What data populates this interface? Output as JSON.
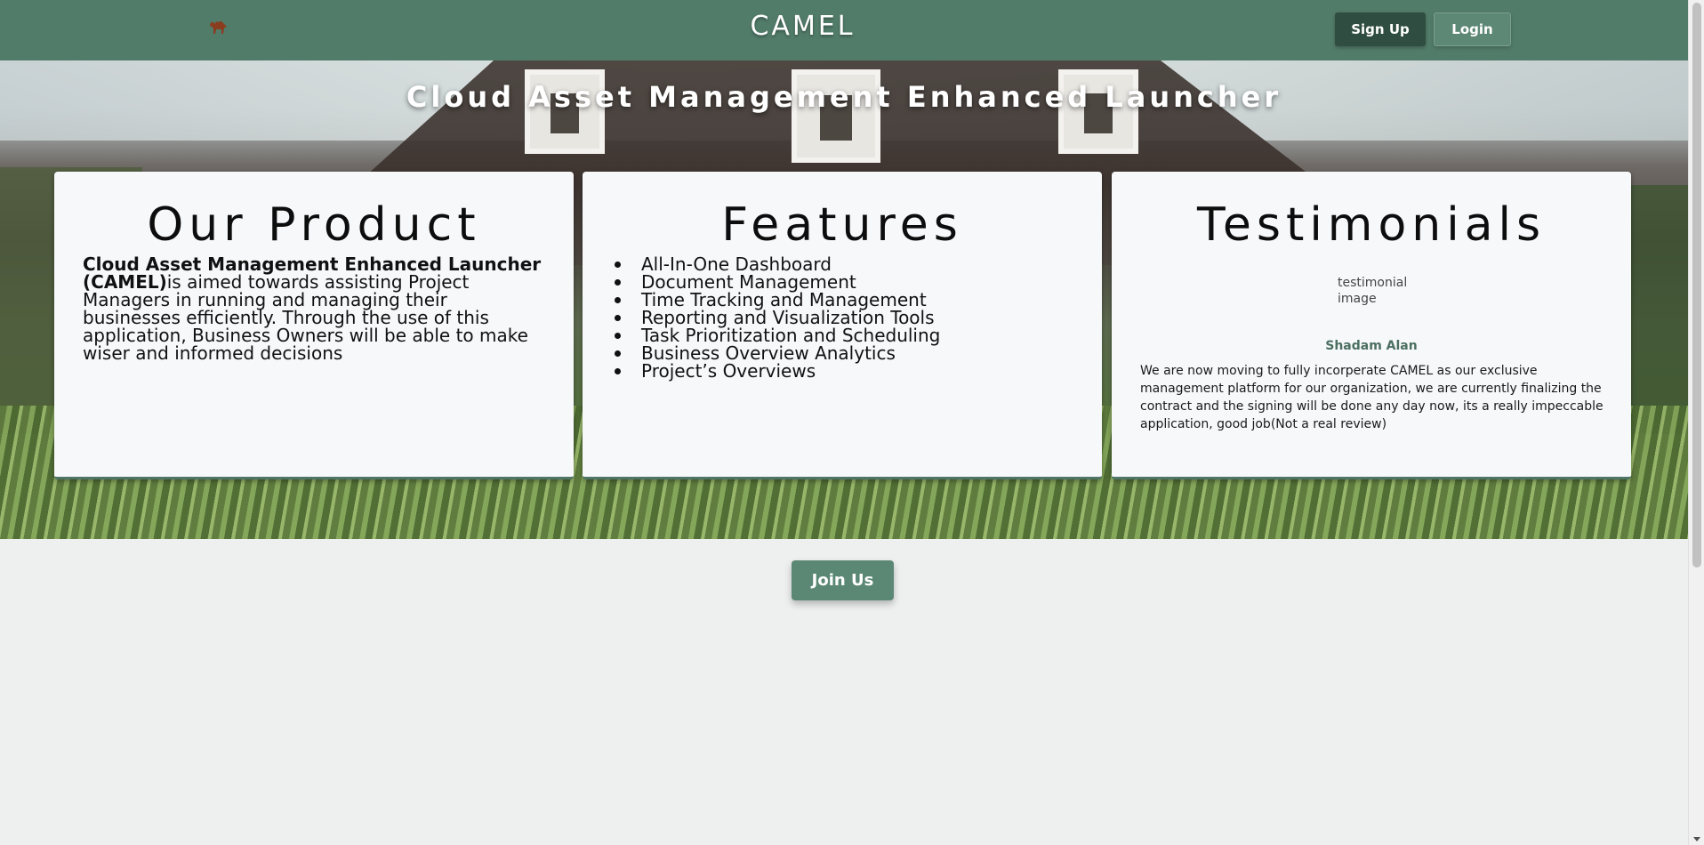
{
  "header": {
    "logo_icon": "camel-icon",
    "brand": "CAMEL",
    "signup_label": "Sign Up",
    "login_label": "Login"
  },
  "hero": {
    "title": "Cloud Asset Management Enhanced Launcher"
  },
  "product": {
    "heading": "Our Product",
    "bold_text": "Cloud Asset Management Enhanced Launcher (CAMEL)",
    "body_text": "is aimed towards assisting Project Managers in running and managing their businesses efficiently. Through the use of this application, Business Owners will be able to make wiser and informed decisions"
  },
  "features": {
    "heading": "Features",
    "items": [
      "All-In-One Dashboard",
      "Document Management",
      "Time Tracking and Management",
      "Reporting and Visualization Tools",
      "Task Prioritization and Scheduling",
      "Business Overview Analytics",
      "Project’s Overviews"
    ]
  },
  "testimonials": {
    "heading": "Testimonials",
    "image_alt": "testimonial image",
    "name": "Shadam Alan",
    "quote": "We are now moving to fully incorperate CAMEL as our exclusive management platform for our organization, we are currently finalizing the contract and the signing will be done any day now, its a really impeccable application, good job(Not a real review)"
  },
  "cta": {
    "join_label": "Join Us"
  },
  "colors": {
    "navbar": "#527c6a",
    "signup_bg": "#2f4d40",
    "join_bg": "#5b8874",
    "name_color": "#4b6f60"
  }
}
